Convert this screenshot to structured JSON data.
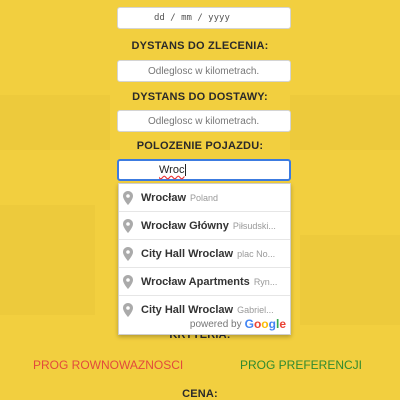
{
  "form": {
    "date_placeholder": "dd / mm / yyyy",
    "dystans_zlecenia_label": "DYSTANS DO ZLECENIA:",
    "dystans_zlecenia_placeholder": "Odleglosc w kilometrach.",
    "dystans_dostawy_label": "DYSTANS DO DOSTAWY:",
    "dystans_dostawy_placeholder": "Odleglosc w kilometrach.",
    "polozenie_label": "POLOZENIE POJAZDU:",
    "polozenie_value": "Wroc",
    "kryteria_label": "KRYTERIA:",
    "prog_rownowaznosci": "PROG ROWNOWAZNOSCI",
    "prog_preferencji": "PROG PREFERENCJI",
    "cena_label": "CENA:"
  },
  "autocomplete": {
    "items": [
      {
        "main": "Wrocław",
        "secondary": "Poland"
      },
      {
        "main": "Wrocław Główny",
        "secondary": "Piłsudski..."
      },
      {
        "main": "City Hall Wroclaw",
        "secondary": "plac No..."
      },
      {
        "main": "Wrocław Apartments",
        "secondary": "Ryn..."
      },
      {
        "main": "City Hall Wroclaw",
        "secondary": "Gabriel..."
      }
    ],
    "powered_by": "powered by",
    "google_logo": [
      "G",
      "o",
      "o",
      "g",
      "l",
      "e"
    ],
    "icon": "map-pin-icon"
  },
  "colors": {
    "background": "#f2cf3f",
    "prog_left": "#e24a3b",
    "prog_right": "#2f8a2f",
    "focus_border": "#3c7be0"
  }
}
